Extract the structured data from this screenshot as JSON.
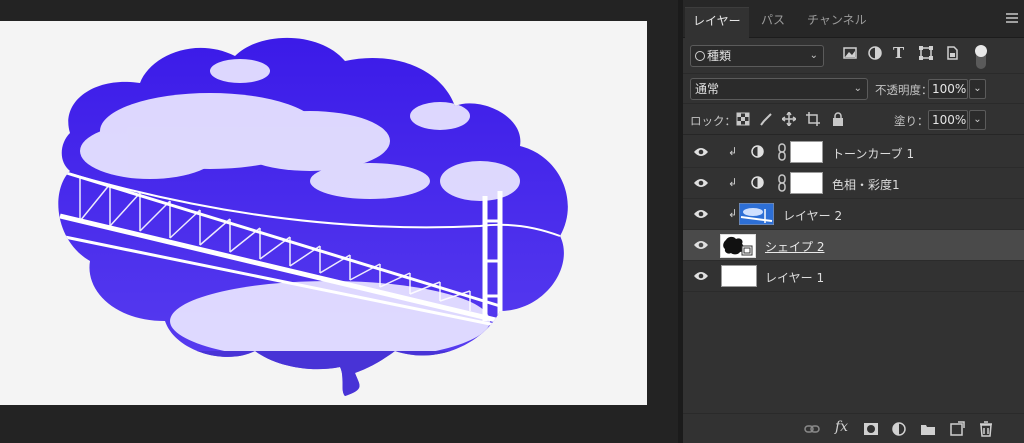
{
  "tabs": [
    {
      "label": "レイヤー",
      "active": true
    },
    {
      "label": "パス",
      "active": false
    },
    {
      "label": "チャンネル",
      "active": false
    }
  ],
  "filter": {
    "kind_value": "種類",
    "icons": [
      "image-filter-icon",
      "adjustment-filter-icon",
      "type-filter-icon",
      "shape-filter-icon",
      "smart-object-filter-icon"
    ]
  },
  "blend": {
    "mode": "通常",
    "opacity_label": "不透明度：",
    "opacity_value": "100%"
  },
  "lock": {
    "label": "ロック：",
    "fill_label": "塗り：",
    "fill_value": "100%"
  },
  "layers": [
    {
      "name": "トーンカーブ 1",
      "type": "adjustment",
      "clipped": true,
      "selected": false
    },
    {
      "name": "色相・彩度1",
      "type": "adjustment",
      "clipped": true,
      "selected": false
    },
    {
      "name": "レイヤー 2",
      "type": "image",
      "clipped": true,
      "selected": false
    },
    {
      "name": "シェイプ 2",
      "type": "shape",
      "clipped": false,
      "selected": true
    },
    {
      "name": "レイヤー 1",
      "type": "fill",
      "clipped": false,
      "selected": false
    }
  ],
  "bottom_icons": [
    "link-layers-icon",
    "fx-icon",
    "add-mask-icon",
    "new-adjustment-icon",
    "new-group-icon",
    "new-layer-icon",
    "delete-layer-icon"
  ],
  "colors": {
    "sky": "#3a19e8",
    "bridge": "#ffffff",
    "canvas": "#f4f4f4",
    "panel": "#323232",
    "selected_layer": "#4a4a4a"
  }
}
